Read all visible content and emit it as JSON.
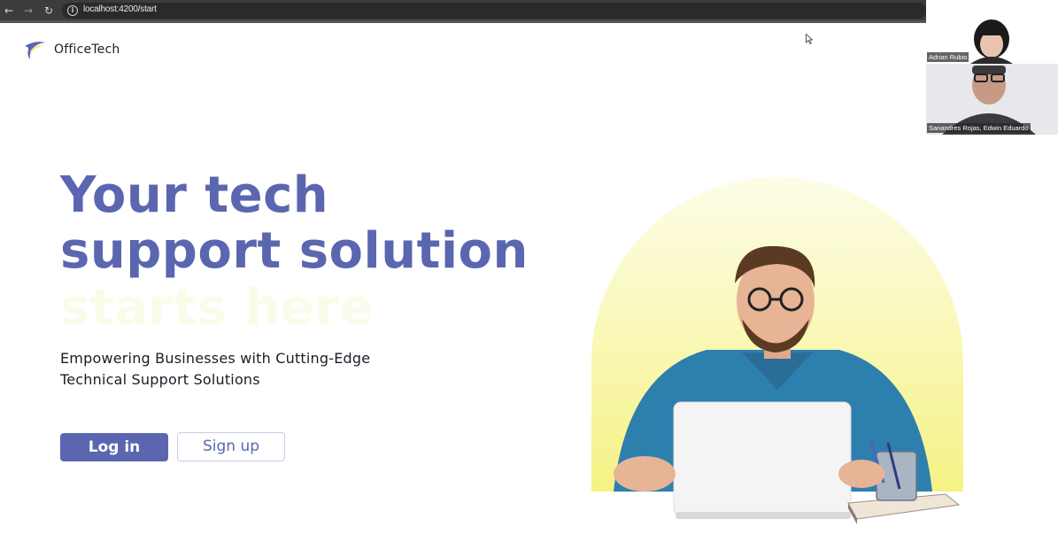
{
  "browser": {
    "back_icon": "arrow-left-icon",
    "forward_icon": "arrow-right-icon",
    "reload_icon": "reload-icon",
    "info_icon": "info-icon",
    "url": "localhost:4200/start"
  },
  "video_call": {
    "participants": [
      {
        "name": "Adrian Rubio"
      },
      {
        "name": "Sanandres Rojas, Edwin Eduardo"
      }
    ]
  },
  "header": {
    "logo_icon": "officetech-swoosh-logo",
    "brand": "OfficeTech"
  },
  "hero": {
    "title_line1": "Your tech",
    "title_line2": "support solution",
    "title_line3": "starts here",
    "subtitle_line1": "Empowering Businesses with Cutting-Edge",
    "subtitle_line2": "Technical Support Solutions",
    "login_label": "Log in",
    "signup_label": "Sign up"
  },
  "colors": {
    "brand_blue": "#5b66b0",
    "highlight_yellow": "#f7f59a",
    "chrome_dark": "#3c3c3c"
  }
}
